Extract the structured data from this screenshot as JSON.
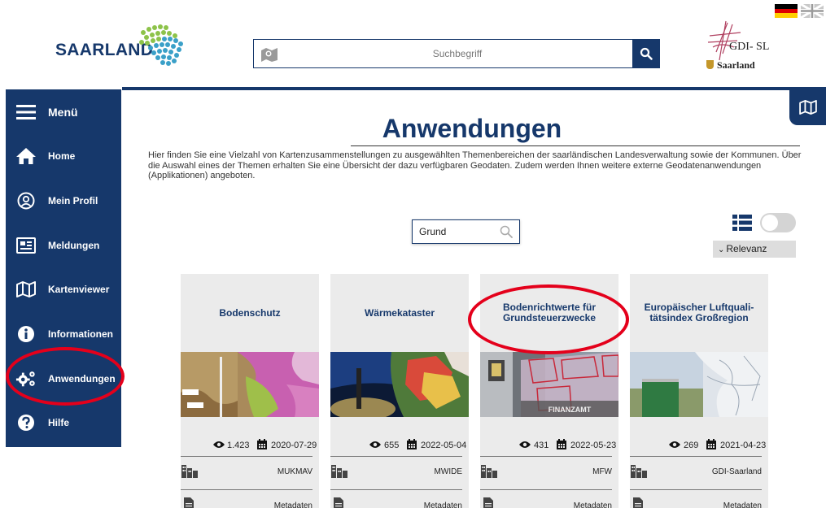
{
  "header": {
    "logo_text": "SAARLAND",
    "search_placeholder": "Suchbegriff",
    "gdi_text": "GDI- SL",
    "gdi_subtext": "Saarland"
  },
  "sidebar": {
    "items": [
      {
        "label": "Menü",
        "icon": "hamburger-icon"
      },
      {
        "label": "Home",
        "icon": "home-icon"
      },
      {
        "label": "Mein Profil",
        "icon": "user-icon"
      },
      {
        "label": "Meldungen",
        "icon": "news-icon"
      },
      {
        "label": "Kartenviewer",
        "icon": "map-icon"
      },
      {
        "label": "Informationen",
        "icon": "info-icon"
      },
      {
        "label": "Anwendungen",
        "icon": "gears-icon"
      },
      {
        "label": "Hilfe",
        "icon": "help-icon"
      }
    ]
  },
  "main": {
    "title": "Anwendungen",
    "intro": "Hier finden Sie eine Vielzahl von Kartenzusammenstellungen zu ausgewählten Themenbereichen der saarländischen Landesverwaltung sowie der Kommunen. Über die Auswahl eines der Themen erhalten Sie eine Übersicht der dazu verfügbaren Geodaten. Zudem werden Ihnen weitere externe Geodatenanwendungen (Applikationen) angeboten.",
    "filter_value": "Grund",
    "sort_label": "Relevanz"
  },
  "cards": [
    {
      "title": "Bodenschutz",
      "views": "1.423",
      "date": "2020-07-29",
      "org": "MUKMAV",
      "meta": "Metadaten"
    },
    {
      "title": "Wärmekataster",
      "views": "655",
      "date": "2022-05-04",
      "org": "MWIDE",
      "meta": "Metadaten"
    },
    {
      "title": "Bodenrichtwerte für Grundsteuerzwecke",
      "views": "431",
      "date": "2022-05-23",
      "org": "MFW",
      "meta": "Metadaten"
    },
    {
      "title": "Europäischer Luftquali-tätsindex Großregion",
      "views": "269",
      "date": "2021-04-23",
      "org": "GDI-Saarland",
      "meta": "Metadaten"
    }
  ],
  "colors": {
    "brand": "#16386b",
    "highlight": "#e4001b",
    "card_bg": "#ebebeb"
  }
}
